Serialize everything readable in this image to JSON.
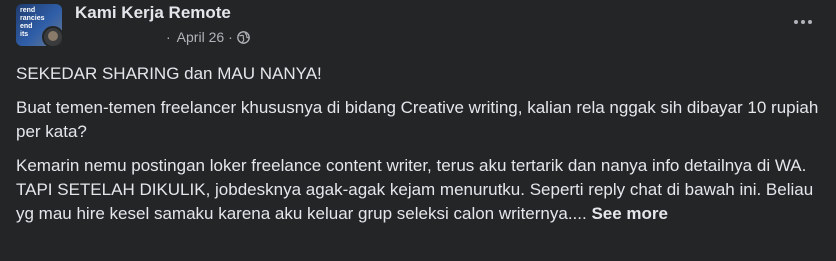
{
  "post": {
    "group_name": "Kami Kerja Remote",
    "avatar_text": "rend\nrancies\nend\nits",
    "date": "April 26",
    "meta_dot": "·",
    "meta_sep": "·",
    "privacy_icon": "globe-icon",
    "more_icon": "more-horizontal-icon",
    "paragraphs": [
      "SEKEDAR SHARING dan MAU NANYA!",
      "Buat temen-temen freelancer khususnya di bidang Creative writing, kalian rela nggak sih dibayar 10 rupiah per kata?",
      "Kemarin nemu postingan loker freelance content writer, terus aku tertarik dan nanya info detailnya di WA. TAPI SETELAH DIKULIK, jobdesknya agak-agak kejam menurutku. Seperti reply chat di bawah ini. Beliau yg mau hire kesel samaku karena aku keluar grup seleksi calon writernya...."
    ],
    "see_more_label": "See more"
  },
  "colors": {
    "background": "#242526",
    "primary_text": "#e4e6eb",
    "secondary_text": "#b0b3b8"
  }
}
